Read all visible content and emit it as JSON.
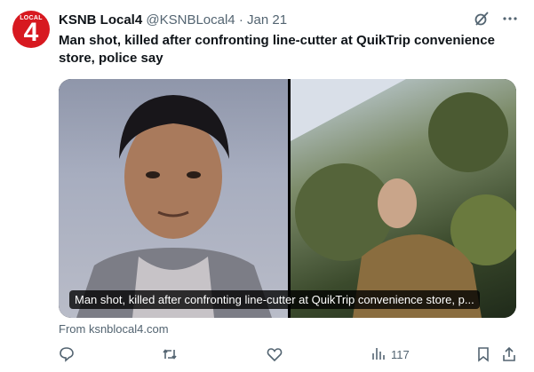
{
  "account": {
    "avatar_word": "LOCAL",
    "avatar_number": "4",
    "name": "KSNB Local4",
    "handle": "@KSNBLocal4",
    "separator": "·",
    "date": "Jan 21"
  },
  "tweet": {
    "headline": "Man shot, killed after confronting line-cutter at QuikTrip convenience store, police say"
  },
  "card": {
    "caption": "Man shot, killed after confronting line-cutter at QuikTrip convenience store, p...",
    "source": "From ksnblocal4.com"
  },
  "actions": {
    "views": "117"
  },
  "icons": {
    "grok": "grok-icon",
    "more": "more-icon",
    "reply": "reply-icon",
    "retweet": "retweet-icon",
    "like": "like-icon",
    "views": "views-icon",
    "bookmark": "bookmark-icon",
    "share": "share-icon"
  },
  "colors": {
    "brand_red": "#d71920",
    "text_primary": "#0f1419",
    "text_secondary": "#536471"
  }
}
